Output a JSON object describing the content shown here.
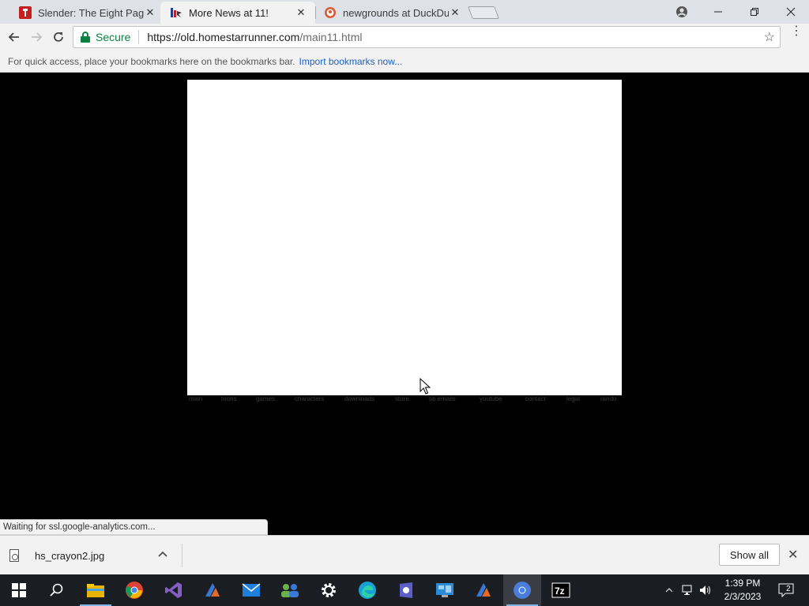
{
  "browser": {
    "tabs": [
      {
        "title": "Slender: The Eight Pages",
        "favicon": "red-wrench-icon",
        "active": false
      },
      {
        "title": "More News at 11!",
        "favicon": "homestarrunner-icon",
        "active": true
      },
      {
        "title": "newgrounds at DuckDuck",
        "favicon": "duckduckgo-icon",
        "active": false
      }
    ],
    "new_tab": "new-tab-icon",
    "window_controls": {
      "profile": "profile-icon",
      "minimize": "minimize-icon",
      "maximize": "restore-icon",
      "close": "close-icon"
    }
  },
  "toolbar": {
    "secure_label": "Secure",
    "url_host": "https://old.homestarrunner.com",
    "url_path": "/main11.html"
  },
  "bookmarks_bar": {
    "message": "For quick access, place your bookmarks here on the bookmarks bar.",
    "import_link": "Import bookmarks now..."
  },
  "page": {
    "footer_nav": [
      "main",
      "toons",
      "games",
      "characters",
      "downloads",
      "store",
      "sb emails",
      "youtube",
      "contact",
      "legal",
      "rando"
    ]
  },
  "status_bar": {
    "text": "Waiting for ssl.google-analytics.com..."
  },
  "download_shelf": {
    "file_name": "hs_crayon2.jpg",
    "show_all_label": "Show all"
  },
  "taskbar": {
    "apps": [
      "start-icon",
      "search-icon",
      "file-explorer-icon",
      "chrome-icon",
      "visual-studio-icon",
      "app-icon",
      "mail-icon",
      "people-icon",
      "settings-icon",
      "edge-icon",
      "app-icon",
      "control-panel-icon",
      "app-icon",
      "chrome-icon",
      "7zip-icon"
    ],
    "time": "1:39 PM",
    "date": "2/3/2023",
    "notifications": "2"
  },
  "colors": {
    "secure_green": "#0b8043",
    "link_blue": "#1a61c9",
    "taskbar": "#1a1d22"
  }
}
